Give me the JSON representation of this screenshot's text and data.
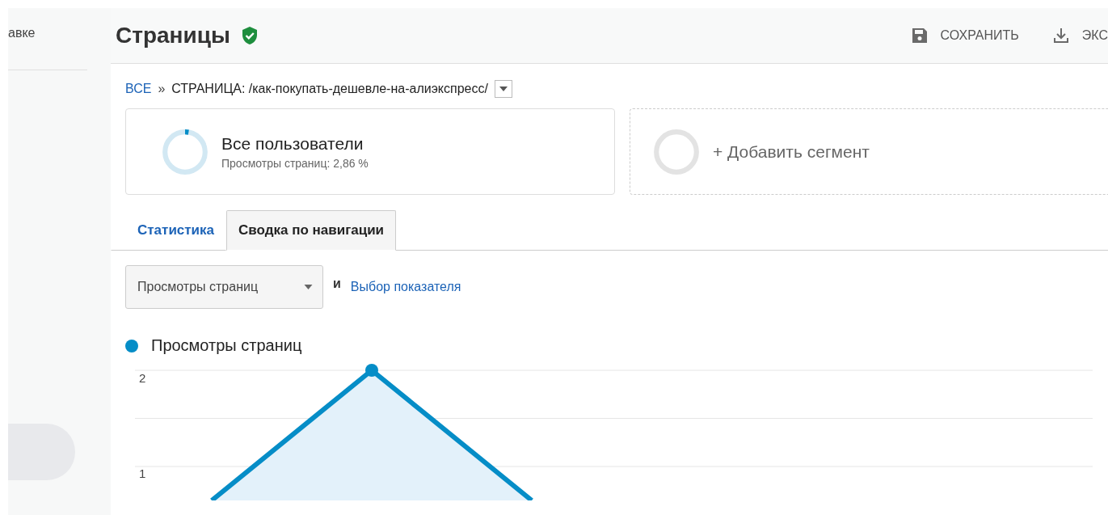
{
  "sidebar": {
    "cut_text": "авке"
  },
  "header": {
    "title": "Страницы",
    "verified": true,
    "actions": [
      {
        "kind": "save",
        "label": "СОХРАНИТЬ"
      },
      {
        "kind": "export",
        "label": "ЭКС"
      }
    ]
  },
  "breadcrumb": {
    "root": "ВСЕ",
    "separator": "»",
    "current": "СТРАНИЦА: /как-покупать-дешевле-на-алиэкспресс/"
  },
  "segments": [
    {
      "kind": "segment",
      "name": "Все пользователи",
      "detail": "Просмотры страниц: 2,86 %",
      "level": 0.0286
    },
    {
      "kind": "add",
      "name": "+ Добавить сегмент"
    }
  ],
  "tabs": [
    {
      "label": "Статистика",
      "selected": false
    },
    {
      "label": "Сводка по навигации",
      "selected": true
    }
  ],
  "metric": {
    "value": "Просмотры страниц",
    "joiner": "и",
    "link": "Выбор показателя"
  },
  "chart": {
    "legend": "Просмотры страниц",
    "y_labels": [
      "2",
      "1"
    ]
  }
}
